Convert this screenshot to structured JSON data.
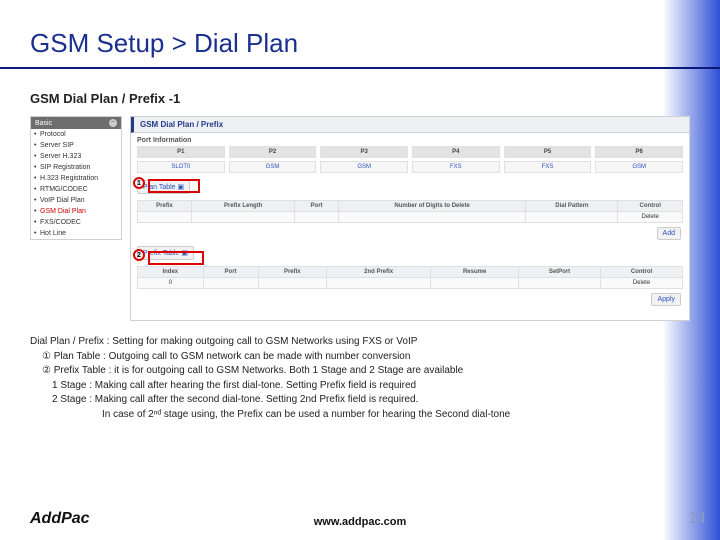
{
  "title": "GSM Setup > Dial Plan",
  "subtitle": "GSM Dial Plan / Prefix -1",
  "sidebar": {
    "head": "Basic",
    "items": [
      "Protocol",
      "Server SIP",
      "Server H.323",
      "SIP Registration",
      "H.323 Registration",
      "RTMG/CODEC",
      "VoIP Dial Plan",
      "GSM Dial Plan",
      "FXS/CODEC",
      "Hot Line"
    ],
    "selected_index": 7
  },
  "panel": {
    "title": "GSM Dial Plan / Prefix",
    "section1": "Port Information",
    "ports_head": [
      "P1",
      "P2",
      "P3",
      "P4",
      "P5",
      "P6"
    ],
    "ports_val": [
      "SLOT0",
      "GSM",
      "GSM",
      "FXS",
      "FXS",
      "GSM"
    ],
    "plan_table_btn": "Plan Table",
    "plan_headers": [
      "Prefix",
      "Prefix Length",
      "Port",
      "Number of Digits to Delete",
      "Dial Pattern",
      "Control"
    ],
    "plan_row_ctrl": "Delete",
    "plan_add_btn": "Add",
    "prefix_table_btn": "Prefix Table",
    "prefix_headers": [
      "Index",
      "Port",
      "Prefix",
      "2nd Prefix",
      "Resume",
      "SetPort",
      "Control"
    ],
    "prefix_row_ctrl": "Delete",
    "prefix_index": "0",
    "apply_btn": "Apply"
  },
  "markers": {
    "m1": "1",
    "m2": "2"
  },
  "explain": {
    "l0": "Dial Plan / Prefix : Setting for making outgoing call to GSM Networks using FXS or VoIP",
    "l1": "① Plan Table : Outgoing call to GSM network can be made with number conversion",
    "l2": "② Prefix Table : it is for outgoing call to GSM Networks. Both 1 Stage and 2 Stage are available",
    "l3": "1 Stage  : Making call after hearing the first dial-tone. Setting Prefix field is required",
    "l4": "2 Stage  : Making call after the second dial-tone. Setting 2nd Prefix field is required.",
    "l5": "In case of 2ⁿᵈ stage using, the Prefix can be used a number for hearing the Second dial-tone"
  },
  "footer": {
    "brand": "AddPac",
    "site": "www.addpac.com",
    "page": "14"
  }
}
